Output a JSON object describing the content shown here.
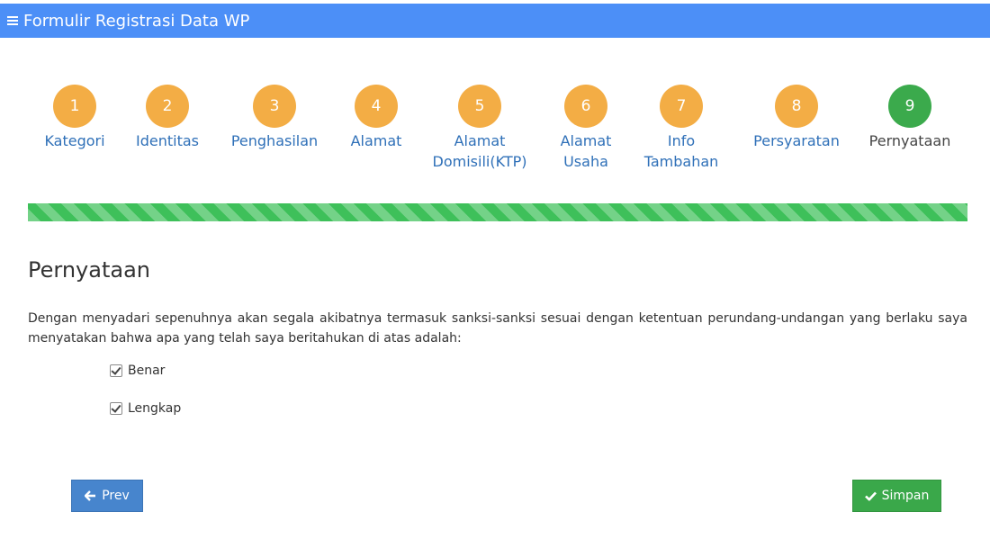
{
  "header": {
    "title": "Formulir Registrasi Data WP"
  },
  "wizard": {
    "steps": [
      {
        "number": "1",
        "label": "Kategori",
        "active": false
      },
      {
        "number": "2",
        "label": "Identitas",
        "active": false
      },
      {
        "number": "3",
        "label": "Penghasilan",
        "active": false
      },
      {
        "number": "4",
        "label": "Alamat",
        "active": false
      },
      {
        "number": "5",
        "label": "Alamat Domisili(KTP)",
        "active": false
      },
      {
        "number": "6",
        "label": "Alamat Usaha",
        "active": false
      },
      {
        "number": "7",
        "label": "Info Tambahan",
        "active": false
      },
      {
        "number": "8",
        "label": "Persyaratan",
        "active": false
      },
      {
        "number": "9",
        "label": "Pernyataan",
        "active": true
      }
    ],
    "progress_percent": 100
  },
  "section": {
    "title": "Pernyataan",
    "statement": "Dengan menyadari sepenuhnya akan segala akibatnya termasuk sanksi-sanksi sesuai dengan ketentuan perundang-undangan yang berlaku saya menyatakan bahwa apa yang telah saya beritahukan di atas adalah:",
    "options": [
      {
        "label": "Benar",
        "checked": true
      },
      {
        "label": "Lengkap",
        "checked": true
      }
    ]
  },
  "buttons": {
    "prev_label": "Prev",
    "save_label": "Simpan"
  },
  "colors": {
    "header": "#4c8ff7",
    "step_pending": "#f3ad45",
    "step_active": "#3baa4c",
    "progress": "#3ec05a",
    "prev_button": "#4785cd",
    "save_button": "#3aa84a"
  },
  "icons": {
    "menu": "menu-icon",
    "prev": "arrow-left-icon",
    "save": "checkmark-icon"
  }
}
